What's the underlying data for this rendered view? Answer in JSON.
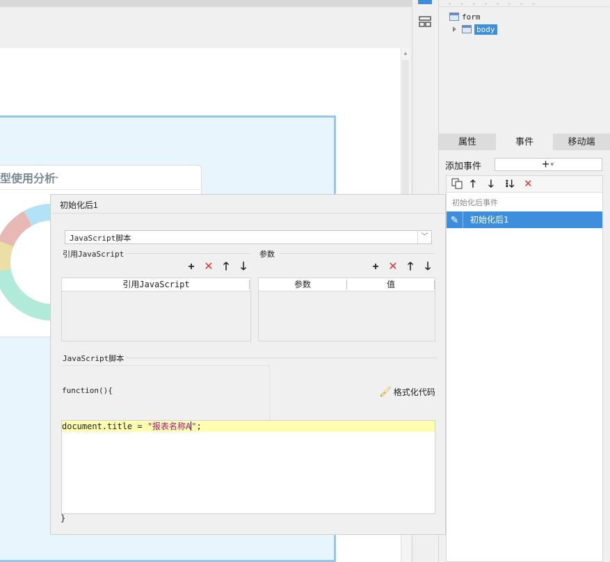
{
  "canvas": {
    "chart_title": "型使用分析",
    "chart_title_suffix": "▪"
  },
  "tree": {
    "root": "form",
    "child": "body"
  },
  "panel": {
    "tabs": [
      "属性",
      "事件",
      "移动端"
    ],
    "active_tab": "事件",
    "add_event_label": "添加事件",
    "add_event_button": "+",
    "event_group": "初始化后事件",
    "event_item": "初始化后1"
  },
  "dialog": {
    "title": "初始化后1",
    "type_select": "JavaScript脚本",
    "ref_section": "引用JavaScript",
    "ref_column": "引用JavaScript",
    "param_section": "参数",
    "param_columns": [
      "参数",
      "值"
    ],
    "script_section": "JavaScript脚本",
    "code_fn": "function(){",
    "format_button": "格式化代码",
    "code_prefix": "document.title = ",
    "code_string_open": "\"报表名称A",
    "code_string_close": "\"",
    "code_suffix": ";",
    "code_close": "}"
  },
  "colors": {
    "accent": "#3d8fdd",
    "delete_red": "#e03434",
    "selection_frame": "#97c6ec",
    "code_highlight": "#fffeb0"
  },
  "icons": [
    "layout-icon",
    "form-icon",
    "body-icon",
    "expand-arrow-icon",
    "copy-icon",
    "move-up-icon",
    "move-down-icon",
    "move-bottom-icon",
    "delete-icon",
    "edit-icon",
    "add-icon",
    "dropdown-icon",
    "brush-icon"
  ]
}
